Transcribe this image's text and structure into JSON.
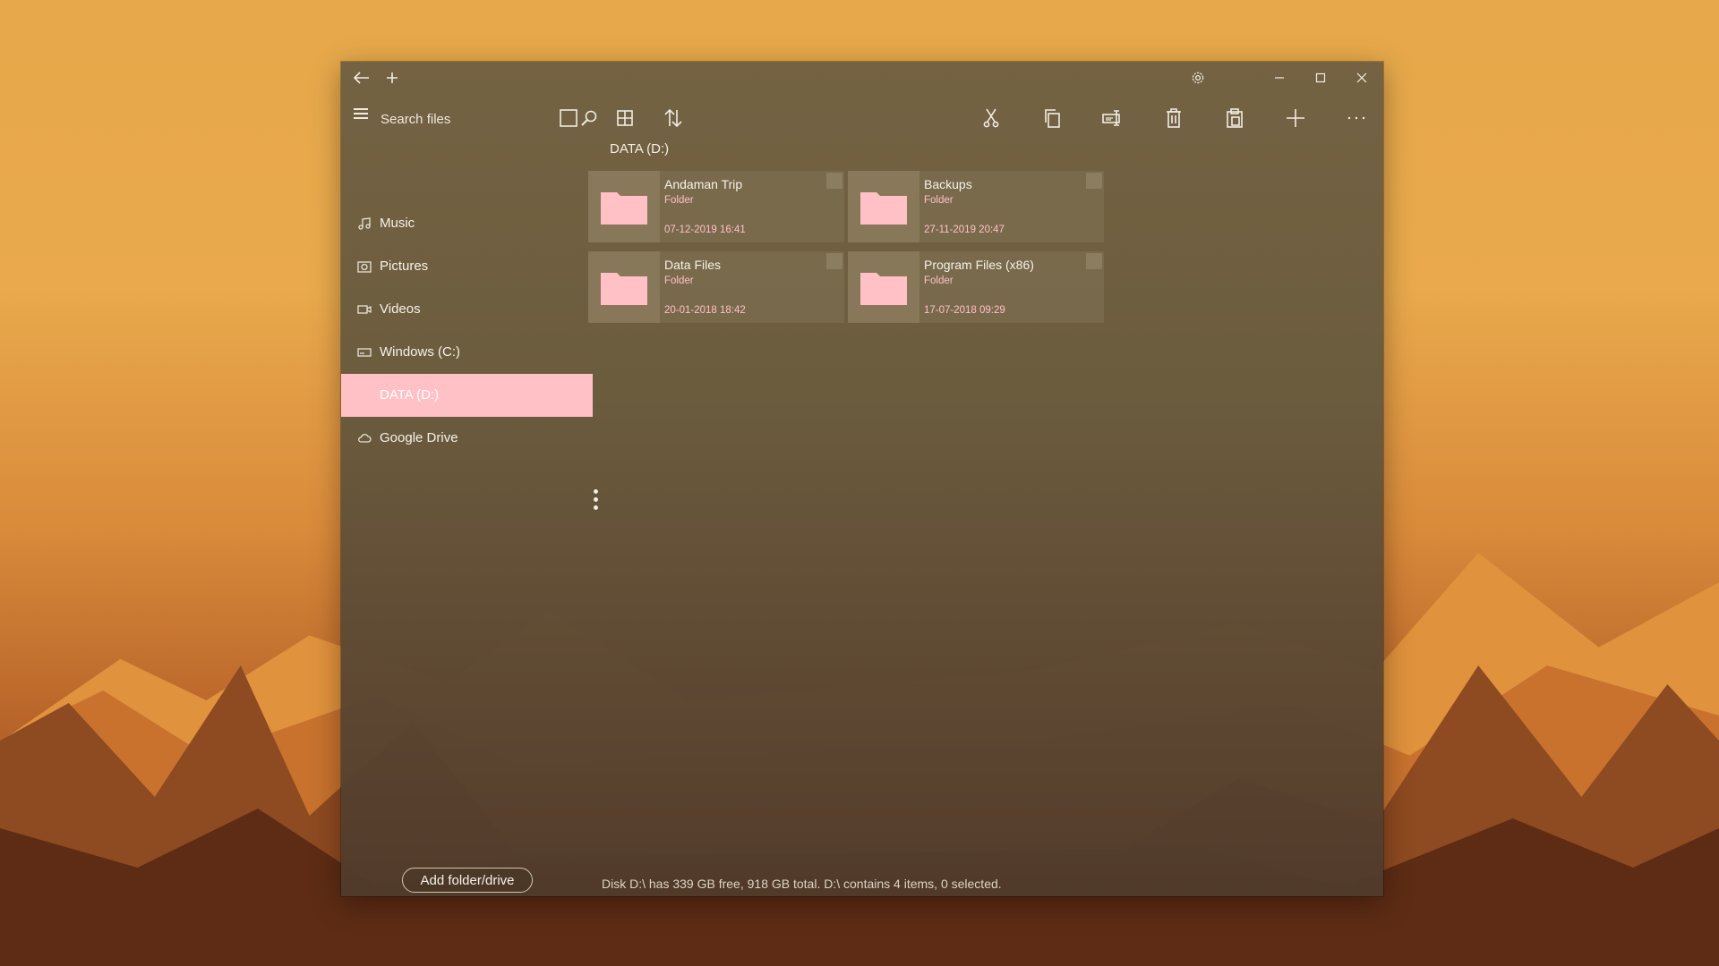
{
  "toolbar": {
    "search_placeholder": "Search files"
  },
  "sidebar": {
    "items": [
      {
        "label": "Music",
        "icon": "music-icon"
      },
      {
        "label": "Pictures",
        "icon": "pictures-icon"
      },
      {
        "label": "Videos",
        "icon": "videos-icon"
      },
      {
        "label": "Windows (C:)",
        "icon": "drive-icon"
      },
      {
        "label": "DATA (D:)",
        "icon": "drive-icon",
        "active": true
      },
      {
        "label": "Google Drive",
        "icon": "cloud-icon"
      }
    ],
    "add_label": "Add folder/drive"
  },
  "main": {
    "breadcrumb": "DATA (D:)",
    "items": [
      {
        "name": "Andaman Trip",
        "type": "Folder",
        "date": "07-12-2019 16:41"
      },
      {
        "name": "Backups",
        "type": "Folder",
        "date": "27-11-2019 20:47"
      },
      {
        "name": "Data Files",
        "type": "Folder",
        "date": "20-01-2018 18:42"
      },
      {
        "name": "Program Files (x86)",
        "type": "Folder",
        "date": "17-07-2018 09:29"
      }
    ]
  },
  "status": "Disk D:\\ has 339 GB free, 918 GB total. D:\\ contains 4 items, 0 selected.",
  "colors": {
    "accent": "#ffc0c6",
    "window_bg": "#6b5c40",
    "text": "#f3efe6"
  }
}
